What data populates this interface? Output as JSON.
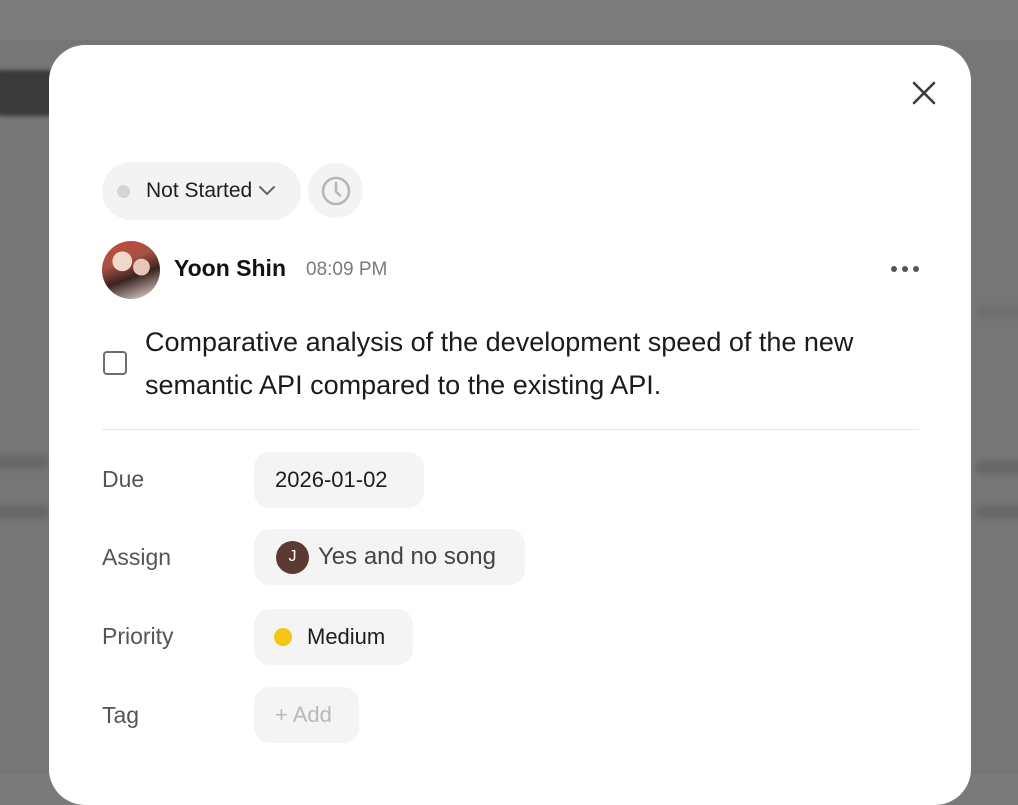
{
  "status": {
    "label": "Not Started",
    "dot_color": "#d4d4d4",
    "icon": "chevron-down-icon"
  },
  "reminder": {
    "icon": "clock-icon"
  },
  "comment": {
    "author": "Yoon Shin",
    "time": "08:09 PM",
    "more_icon": "more-horizontal-icon"
  },
  "task": {
    "text": "Comparative analysis of the development speed of the new semantic API compared to the existing API.",
    "checked": false
  },
  "properties": {
    "due": {
      "label": "Due",
      "value": "2026-01-02"
    },
    "assign": {
      "label": "Assign",
      "initial": "J",
      "value": "Yes and no song"
    },
    "priority": {
      "label": "Priority",
      "value": "Medium",
      "color": "#f5c518"
    },
    "tag": {
      "label": "Tag",
      "placeholder": "+ Add"
    }
  },
  "close_icon": "close-icon"
}
